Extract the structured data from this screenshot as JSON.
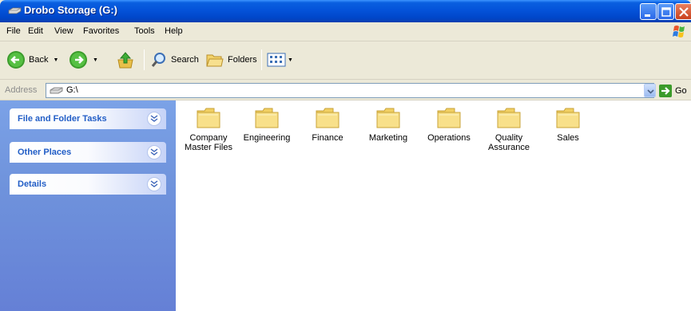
{
  "window": {
    "title": "Drobo Storage (G:)",
    "colors": {
      "titlebar": "#0453d9",
      "taskpane": "#6f93dc",
      "panel_title": "#215dc6"
    }
  },
  "menubar": {
    "items": [
      "File",
      "Edit",
      "View",
      "Favorites",
      "Tools",
      "Help"
    ]
  },
  "toolbar": {
    "back_label": "Back",
    "search_label": "Search",
    "folders_label": "Folders"
  },
  "address": {
    "label": "Address",
    "value": "G:\\",
    "go_label": "Go"
  },
  "taskpane": {
    "panels": [
      {
        "title": "File and Folder Tasks"
      },
      {
        "title": "Other Places"
      },
      {
        "title": "Details"
      }
    ]
  },
  "content": {
    "folders": [
      {
        "line1": "Company",
        "line2": "Master Files"
      },
      {
        "line1": "Engineering",
        "line2": ""
      },
      {
        "line1": "Finance",
        "line2": ""
      },
      {
        "line1": "Marketing",
        "line2": ""
      },
      {
        "line1": "Operations",
        "line2": ""
      },
      {
        "line1": "Quality",
        "line2": "Assurance"
      },
      {
        "line1": "Sales",
        "line2": ""
      }
    ]
  }
}
